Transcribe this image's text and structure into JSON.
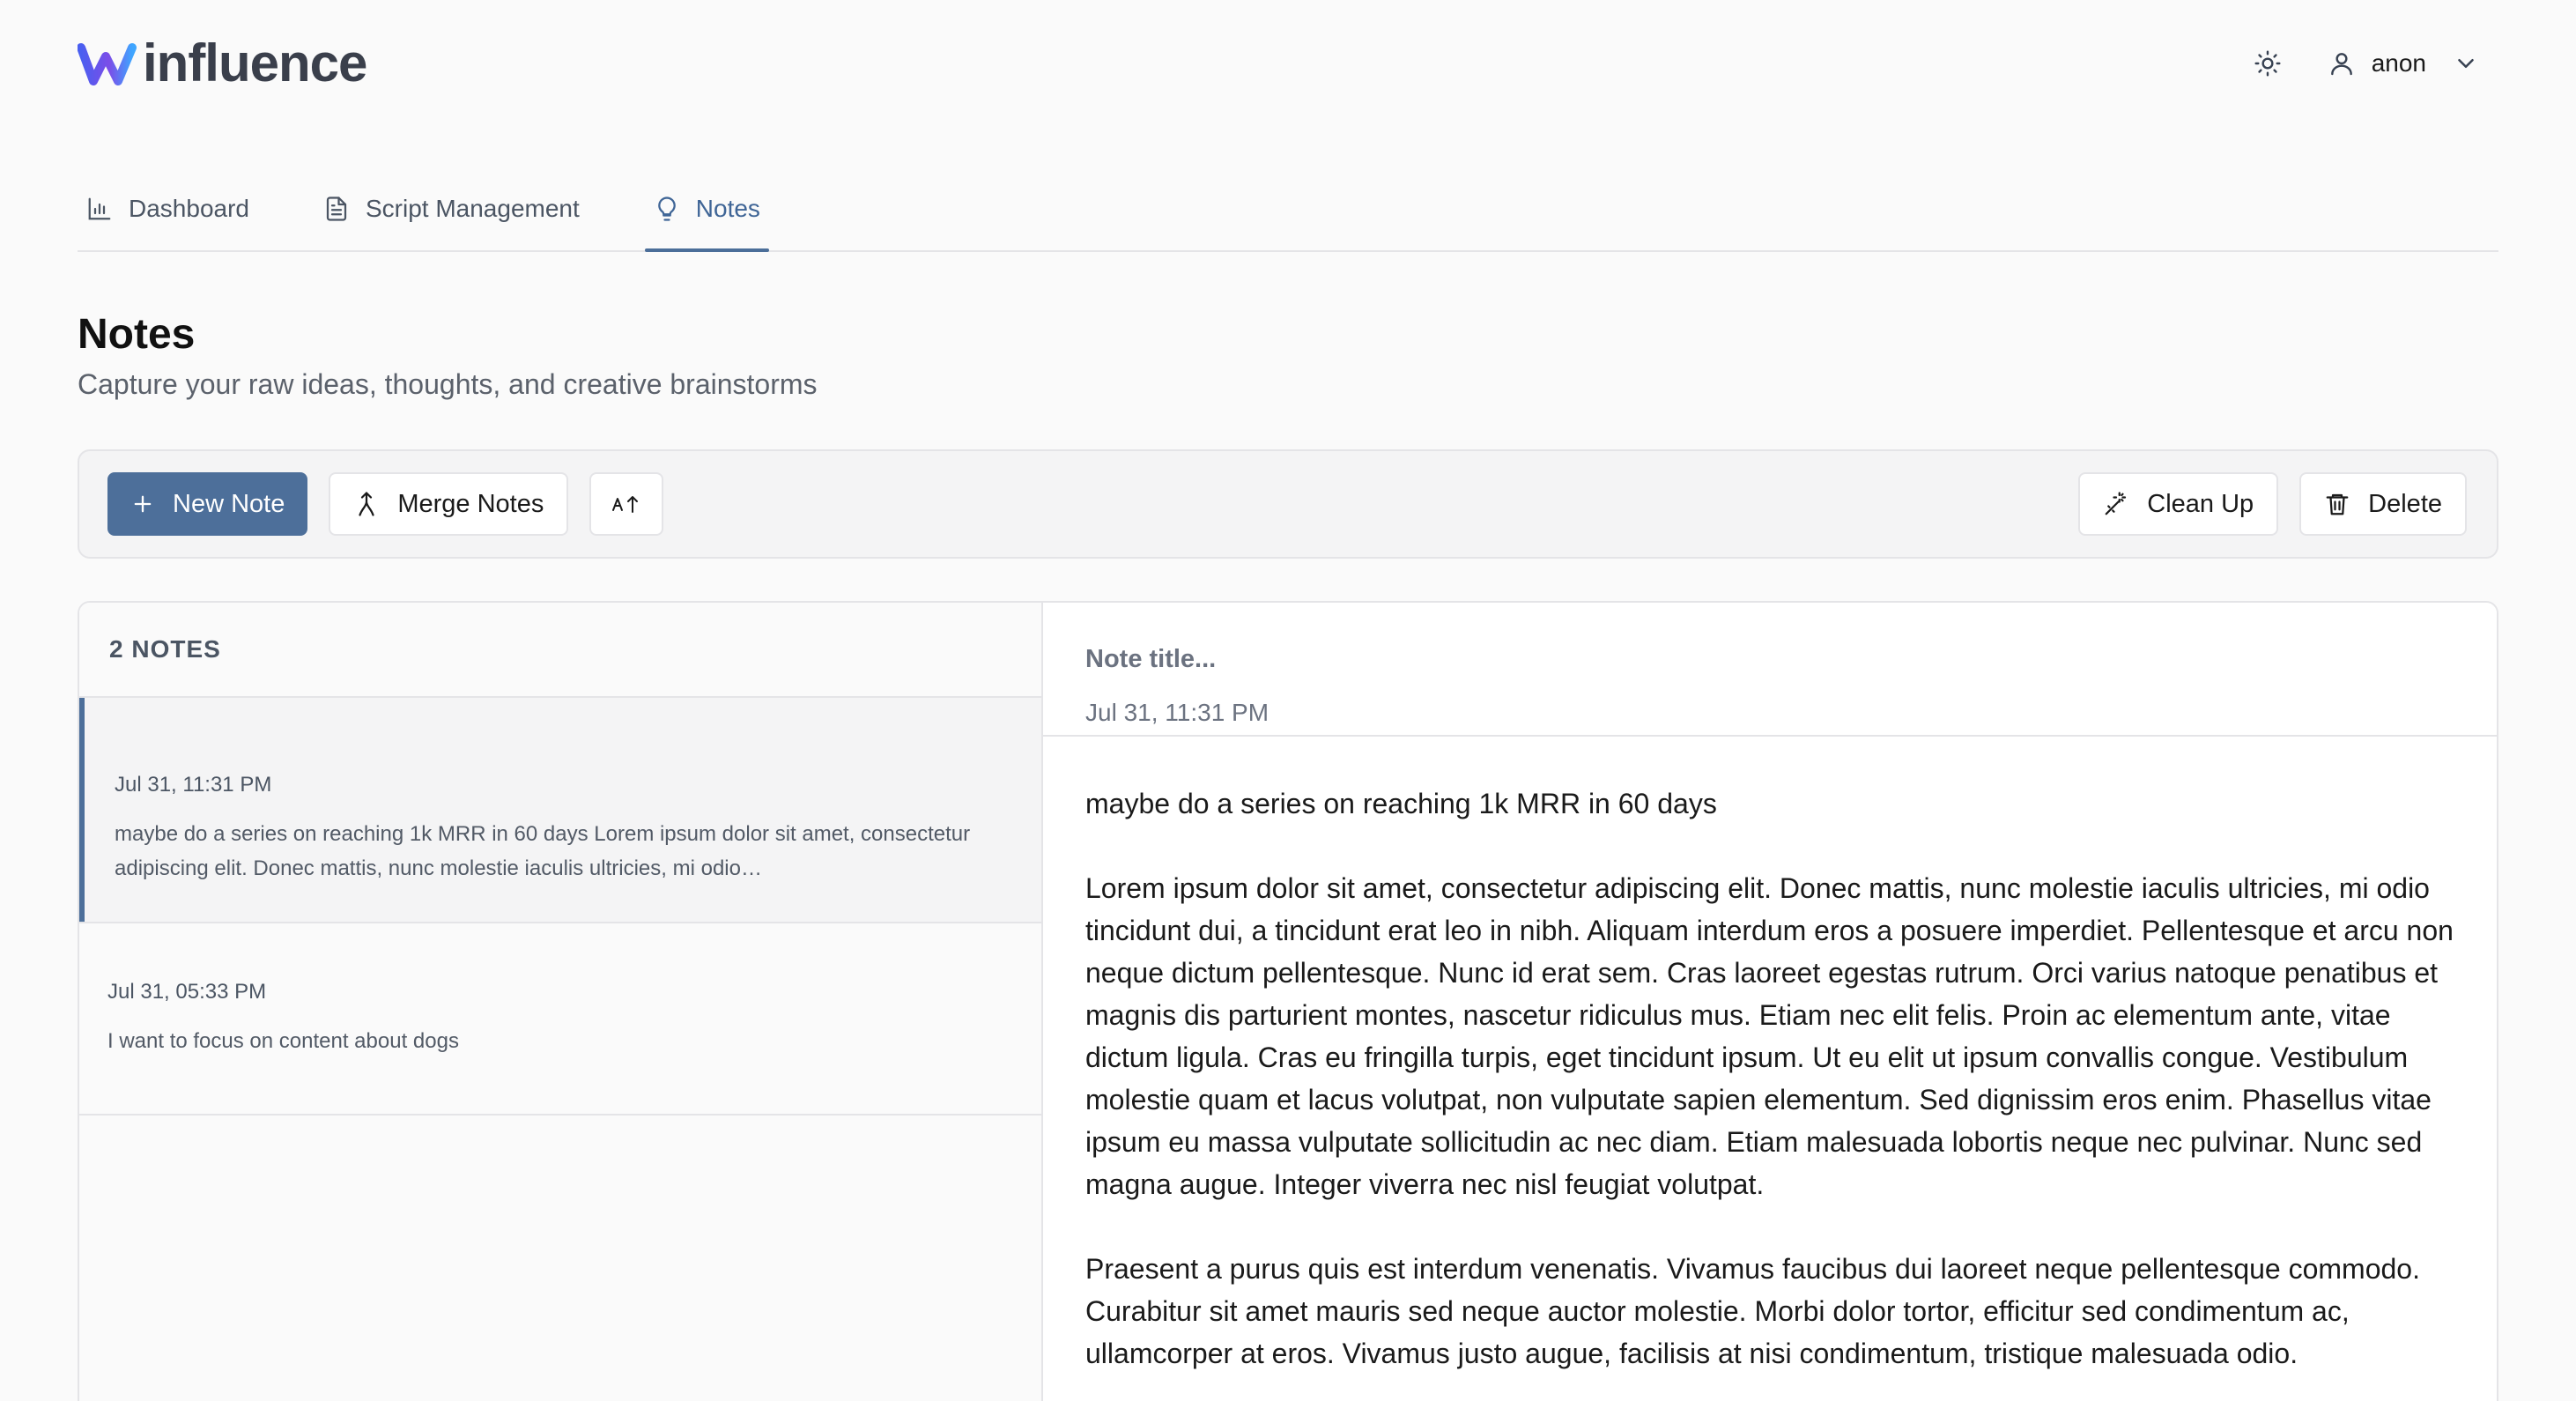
{
  "app": {
    "name": "influence",
    "brand_color": "#4d6f9a"
  },
  "header": {
    "user_name": "anon",
    "icons": [
      "sun-icon",
      "user-icon",
      "chevron-down-icon"
    ]
  },
  "tabs": [
    {
      "label": "Dashboard",
      "icon": "bar-chart-icon",
      "active": false
    },
    {
      "label": "Script Management",
      "icon": "document-icon",
      "active": false
    },
    {
      "label": "Notes",
      "icon": "lightbulb-icon",
      "active": true
    }
  ],
  "page": {
    "title": "Notes",
    "subtitle": "Capture your raw ideas, thoughts, and creative brainstorms"
  },
  "toolbar": {
    "new_note_label": "New Note",
    "merge_notes_label": "Merge Notes",
    "sort_icon": "sort-az-icon",
    "clean_up_label": "Clean Up",
    "delete_label": "Delete"
  },
  "notes_list": {
    "count_label": "2 NOTES",
    "items": [
      {
        "date": "Jul 31, 11:31 PM",
        "preview": "maybe do a series on reaching 1k MRR in 60 days Lorem ipsum dolor sit amet, consectetur adipiscing elit. Donec mattis, nunc molestie iaculis ultricies, mi odio…",
        "selected": true
      },
      {
        "date": "Jul 31, 05:33 PM",
        "preview": "I want to focus on content about dogs",
        "selected": false
      }
    ]
  },
  "editor": {
    "title_placeholder": "Note title...",
    "date": "Jul 31, 11:31 PM",
    "paragraphs": [
      "maybe do a series on reaching 1k MRR in 60 days",
      "Lorem ipsum dolor sit amet, consectetur adipiscing elit. Donec mattis, nunc molestie iaculis ultricies, mi odio tincidunt dui, a tincidunt erat leo in nibh. Aliquam interdum eros a posuere imperdiet. Pellentesque et arcu non neque dictum pellentesque. Nunc id erat sem. Cras laoreet egestas rutrum. Orci varius natoque penatibus et magnis dis parturient montes, nascetur ridiculus mus. Etiam nec elit felis. Proin ac elementum ante, vitae dictum ligula. Cras eu fringilla turpis, eget tincidunt ipsum. Ut eu elit ut ipsum convallis congue. Vestibulum molestie quam et lacus volutpat, non vulputate sapien elementum. Sed dignissim eros enim. Phasellus vitae ipsum eu massa vulputate sollicitudin ac nec diam. Etiam malesuada lobortis neque nec pulvinar. Nunc sed magna augue. Integer viverra nec nisl feugiat volutpat.",
      "Praesent a purus quis est interdum venenatis. Vivamus faucibus dui laoreet neque pellentesque commodo. Curabitur sit amet mauris sed neque auctor molestie. Morbi dolor tortor, efficitur sed condimentum ac, ullamcorper at eros. Vivamus justo augue, facilisis at nisi condimentum, tristique malesuada odio."
    ]
  }
}
